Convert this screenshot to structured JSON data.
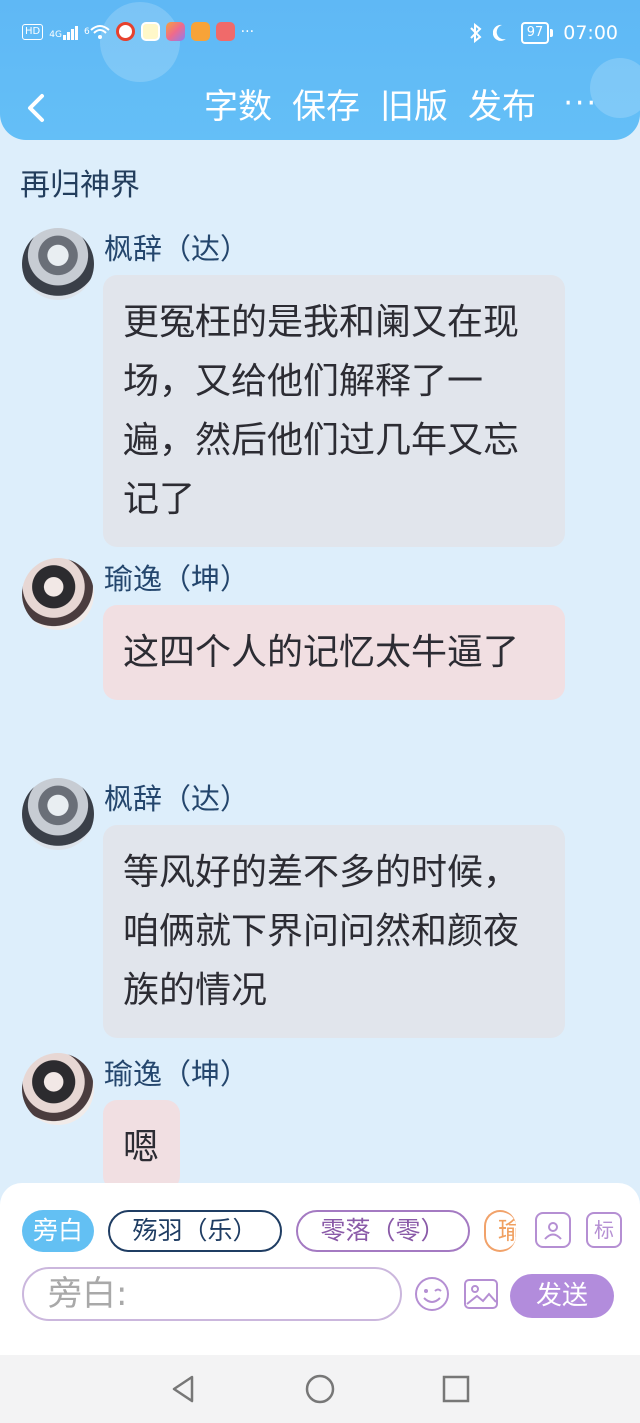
{
  "status_bar": {
    "network": "HD",
    "signal_gen": "4G",
    "wifi_gen": "6",
    "more_notifications": "···",
    "battery": "97",
    "time": "07:00"
  },
  "nav": {
    "word_count": "字数",
    "save": "保存",
    "old_version": "旧版",
    "publish": "发布",
    "more": "···"
  },
  "chat": {
    "title": "再归神界",
    "messages": [
      {
        "sender": "枫辞（达）",
        "text": "更冤枉的是我和阑又在现场，又给他们解释了一遍，然后他们过几年又忘记了"
      },
      {
        "sender": "瑜逸（坤）",
        "text": "这四个人的记忆太牛逼了"
      },
      {
        "sender": "枫辞（达）",
        "text": "等风好的差不多的时候，咱俩就下界问问然和颜夜族的情况"
      },
      {
        "sender": "瑜逸（坤）",
        "text": "嗯"
      }
    ]
  },
  "composer": {
    "roles": [
      "旁白",
      "殇羽（乐）",
      "零落（零）",
      "瑜"
    ],
    "tag_label": "标",
    "input_placeholder": "旁白:",
    "send_label": "发送"
  },
  "colors": {
    "header": "#5fb8f5",
    "background": "#ddeefb",
    "bubble_grey": "#e1e5ec",
    "bubble_pink": "#f1dfe2",
    "send_button": "#b28cdc"
  },
  "icons": [
    "back-icon",
    "more-icon",
    "bluetooth-icon",
    "moon-icon",
    "battery-icon",
    "emoji-icon",
    "image-icon",
    "contact-icon",
    "nav-back-icon",
    "nav-home-icon",
    "nav-recents-icon"
  ]
}
